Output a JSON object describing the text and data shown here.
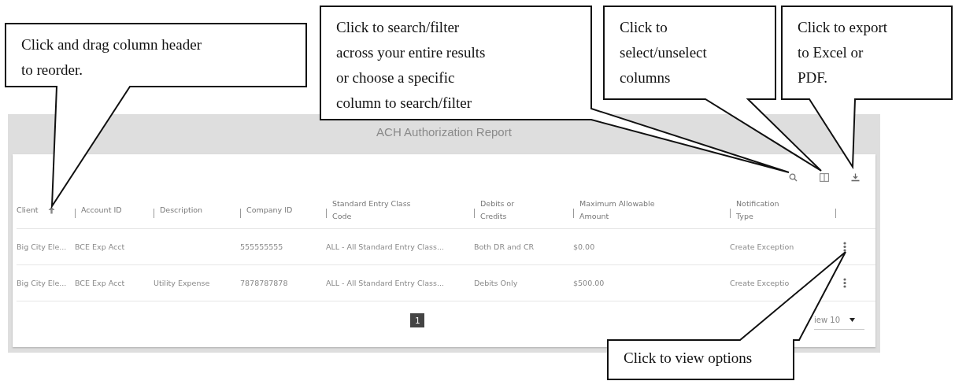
{
  "report": {
    "title": "ACH Authorization Report"
  },
  "columns": [
    {
      "label": "Client",
      "sorted": true
    },
    {
      "label": "Account ID",
      "sorted": false
    },
    {
      "label": "Description",
      "sorted": false
    },
    {
      "label": "Company ID",
      "sorted": false
    },
    {
      "label": "Standard Entry Class Code",
      "sorted": false
    },
    {
      "label": "Debits or Credits",
      "sorted": false
    },
    {
      "label": "Maximum Allowable Amount",
      "sorted": false
    },
    {
      "label": "Notification Type",
      "sorted": false
    }
  ],
  "rows": [
    {
      "cells": [
        "Big City Ele...",
        "BCE Exp Acct",
        null,
        "555555555",
        "ALL - All Standard Entry Class...",
        "Both DR and CR",
        "$0.00",
        "Create Exception"
      ]
    },
    {
      "cells": [
        "Big City Ele...",
        "BCE Exp Acct",
        "Utility Expense",
        "7878787878",
        "ALL - All Standard Entry Class...",
        "Debits Only",
        "$500.00",
        "Create Exceptio"
      ]
    }
  ],
  "pagination": {
    "pages": [
      {
        "label": "1",
        "selected": true
      }
    ],
    "page_size": "iew 10"
  },
  "callouts": [
    {
      "text": "Click and drag column header\nto reorder."
    },
    {
      "text": "Click to search/filter\nacross your entire results\nor choose a specific\ncolumn to search/filter"
    },
    {
      "text": "Click to\nselect/unselect\ncolumns"
    },
    {
      "text": "Click to export\nto Excel or\nPDF."
    },
    {
      "text": "Click to view options"
    }
  ]
}
